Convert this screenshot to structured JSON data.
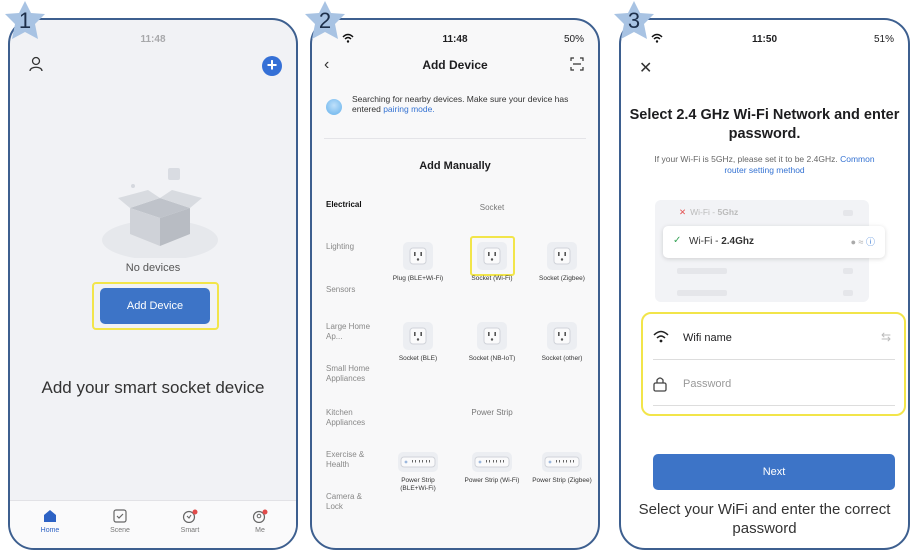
{
  "steps": [
    {
      "number": "1"
    },
    {
      "number": "2"
    },
    {
      "number": "3"
    }
  ],
  "panel1": {
    "status_time": "11:48",
    "empty_label": "No devices",
    "add_device_button": "Add Device",
    "caption": "Add your smart socket device",
    "tabs": [
      {
        "label": "Home",
        "icon": "home-icon",
        "active": true
      },
      {
        "label": "Scene",
        "icon": "scene-icon"
      },
      {
        "label": "Smart",
        "icon": "smart-icon"
      },
      {
        "label": "Me",
        "icon": "me-icon"
      }
    ]
  },
  "panel2": {
    "status_time": "11:48",
    "status_battery": "50%",
    "title": "Add Device",
    "search_text": "Searching for nearby devices. Make sure your device has entered ",
    "search_link": "pairing mode.",
    "add_manually": "Add Manually",
    "categories": [
      "Electrical",
      "Lighting",
      "Sensors",
      "Large Home Ap...",
      "Small Home Appliances",
      "Kitchen Appliances",
      "Exercise & Health",
      "Camera & Lock"
    ],
    "section_socket": "Socket",
    "section_power_strip": "Power Strip",
    "socket_devices": [
      "Plug (BLE+Wi-Fi)",
      "Socket (Wi-Fi)",
      "Socket (Zigbee)",
      "Socket (BLE)",
      "Socket (NB-IoT)",
      "Socket (other)"
    ],
    "strip_devices": [
      "Power Strip (BLE+Wi-Fi)",
      "Power Strip (Wi-Fi)",
      "Power Strip (Zigbee)"
    ]
  },
  "panel3": {
    "status_time": "11:50",
    "status_battery": "51%",
    "title": "Select 2.4 GHz Wi-Fi Network and enter password.",
    "subtitle": "If your Wi-Fi is 5GHz, please set it to be 2.4GHz. ",
    "subtitle_link": "Common router setting method",
    "wifi_5g_prefix": "Wi-Fi - ",
    "wifi_5g_band": "5Ghz",
    "wifi_24_prefix": "Wi-Fi - ",
    "wifi_24_band": "2.4Ghz",
    "wifi_name_label": "Wifi name",
    "password_placeholder": "Password",
    "next_button": "Next",
    "caption": "Select your WiFi and enter the correct password"
  },
  "colors": {
    "accent": "#3d74c7",
    "highlight": "#f2e54a",
    "frame": "#3d5f8f"
  }
}
